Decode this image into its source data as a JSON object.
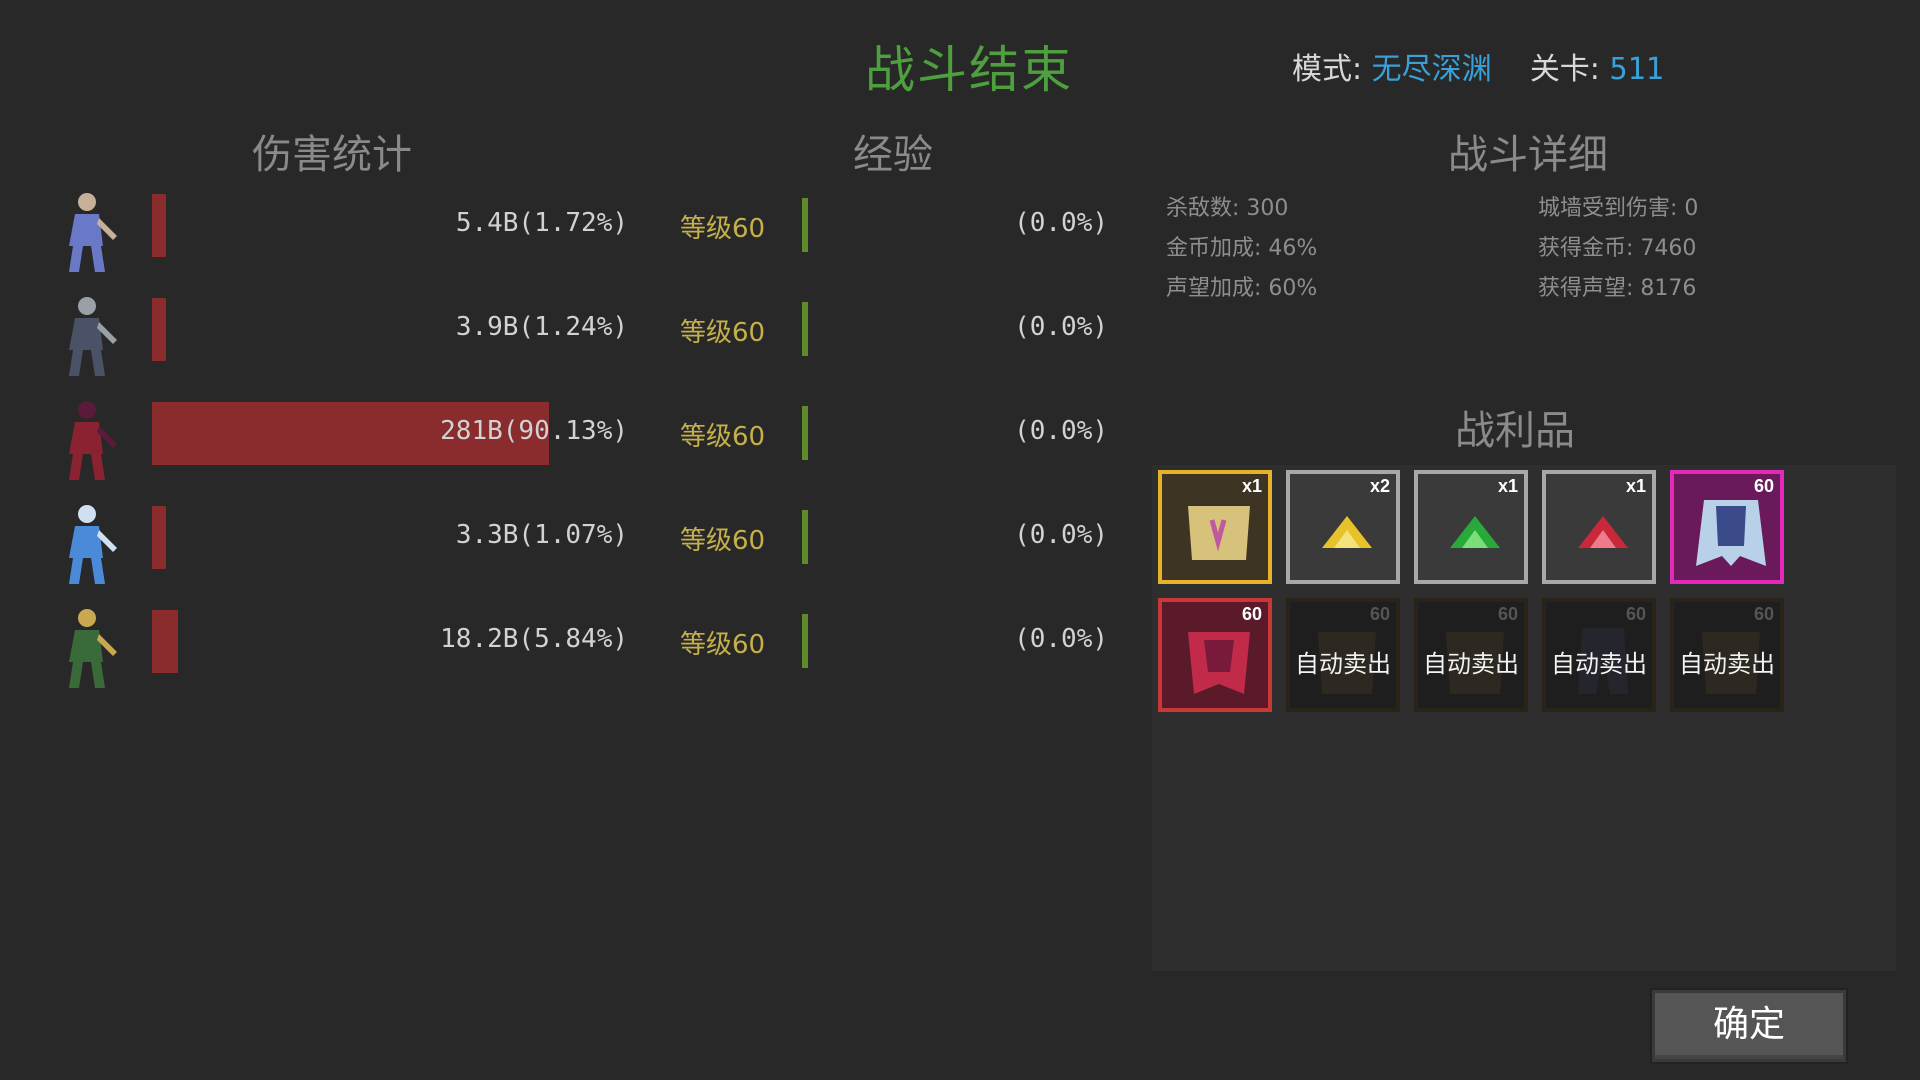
{
  "header": {
    "title": "战斗结束",
    "mode_label": "模式:",
    "mode_value": "无尽深渊",
    "stage_label": "关卡:",
    "stage_value": "511"
  },
  "sections": {
    "damage": "伤害统计",
    "exp": "经验",
    "details": "战斗详细",
    "loot": "战利品"
  },
  "heroes": [
    {
      "icon": "warrior-woman-hero-icon",
      "damage_text": "5.4B(1.72%)",
      "damage_pct": 1.72,
      "level_text": "等级60",
      "xp_text": "(0.0%)"
    },
    {
      "icon": "armored-swordsman-hero-icon",
      "damage_text": "3.9B(1.24%)",
      "damage_pct": 1.24,
      "level_text": "等级60",
      "xp_text": "(0.0%)"
    },
    {
      "icon": "red-mage-hero-icon",
      "damage_text": "281B(90.13%)",
      "damage_pct": 90.13,
      "level_text": "等级60",
      "xp_text": "(0.0%)"
    },
    {
      "icon": "ice-sorceress-hero-icon",
      "damage_text": "3.3B(1.07%)",
      "damage_pct": 1.07,
      "level_text": "等级60",
      "xp_text": "(0.0%)"
    },
    {
      "icon": "elf-archer-hero-icon",
      "damage_text": "18.2B(5.84%)",
      "damage_pct": 5.84,
      "level_text": "等级60",
      "xp_text": "(0.0%)"
    }
  ],
  "details": {
    "kills": "杀敌数: 300",
    "gold_bonus": "金币加成: 46%",
    "fame_bonus": "声望加成: 60%",
    "wall_damage": "城墙受到伤害: 0",
    "gold_gained": "获得金币: 7460",
    "fame_gained": "获得声望: 8176"
  },
  "loot": {
    "row1": [
      {
        "icon": "scroll-icon",
        "count": "x1"
      },
      {
        "icon": "yellow-gem-icon",
        "count": "x2"
      },
      {
        "icon": "green-gem-icon",
        "count": "x1"
      },
      {
        "icon": "red-gem-icon",
        "count": "x1"
      },
      {
        "icon": "ice-armor-icon",
        "count": "60"
      }
    ],
    "row2": [
      {
        "icon": "red-armor-icon",
        "count": "60"
      },
      {
        "icon": "armor-icon",
        "count": "60",
        "label": "自动卖出"
      },
      {
        "icon": "armor-icon",
        "count": "60",
        "label": "自动卖出"
      },
      {
        "icon": "pants-icon",
        "count": "60",
        "label": "自动卖出"
      },
      {
        "icon": "armor-icon",
        "count": "60",
        "label": "自动卖出"
      }
    ]
  },
  "confirm_label": "确定",
  "colors": {
    "accent_green": "#4e9f3d",
    "link_blue": "#3aa0d8",
    "damage_bar": "#8a2b2e",
    "level_gold": "#c6b04a"
  }
}
